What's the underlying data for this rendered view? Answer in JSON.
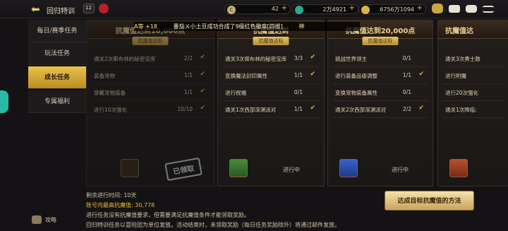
{
  "header": {
    "title": "回归特训",
    "currency1": "42",
    "currency2": "2万4921",
    "currency3": "6756万1094",
    "calendar_date": "12"
  },
  "sidebar": {
    "items": [
      {
        "label": "每日/赛季任务"
      },
      {
        "label": "玩法任务"
      },
      {
        "label": "成长任务"
      },
      {
        "label": "专属福利"
      }
    ],
    "guide_label": "攻略"
  },
  "broadcast": {
    "prefix": "番茄ㄨ小土豆成功合成了9级红色徽章[四维]",
    "leading": "A等  +18",
    "trailing": "神  "
  },
  "cards": [
    {
      "title": "抗魔值达到18,000点",
      "badge": "抗魔值达标",
      "tasks": [
        {
          "name": "通关2次斯布林的秘密宝库",
          "progress": "2/2"
        },
        {
          "name": "装备宠物",
          "progress": "1/1"
        },
        {
          "name": "穿戴宠物装备",
          "progress": "1/1"
        },
        {
          "name": "进行10次强化",
          "progress": "10/10"
        }
      ],
      "status": "已领取"
    },
    {
      "title": "抗魔值达到",
      "badge": "抗魔值达标",
      "tasks": [
        {
          "name": "通关3次哥布林的秘密宝库",
          "progress": "3/3"
        },
        {
          "name": "变换魔法封印属性",
          "progress": "1/1"
        },
        {
          "name": "进行祝福",
          "progress": "0/1"
        },
        {
          "name": "通关1次西部深渊派对",
          "progress": "1/1"
        }
      ],
      "status": "进行中"
    },
    {
      "title": "抗魔值达到20,000点",
      "badge": "抗魔值达标",
      "tasks": [
        {
          "name": "挑战世界领主",
          "progress": "0/1"
        },
        {
          "name": "进行装备品级调整",
          "progress": "1/1"
        },
        {
          "name": "变换宠物装备属性",
          "progress": "0/1"
        },
        {
          "name": "通关2次西部深渊派对",
          "progress": "2/2"
        }
      ],
      "status": "进行中"
    },
    {
      "title": "抗魔值达",
      "tasks": [
        {
          "name": "通关3次勇士鼓"
        },
        {
          "name": "进行附魔"
        },
        {
          "name": "进行20次强化"
        },
        {
          "name": "通关1次降临:"
        }
      ]
    }
  ],
  "footer": {
    "remaining": "剩余进行时间: 10天",
    "max_value": "账号内最高抗魔值: 30,778",
    "note1": "进行任务没有抗魔值要求，但需要满足抗魔值条件才能领取奖励。",
    "note2": "回归特训任务以冒险团为单位发放。活动结束时，未领取奖励（每日任务奖励除外）将通过邮件发放。",
    "method_button": "达成目标抗魔值的方法"
  }
}
